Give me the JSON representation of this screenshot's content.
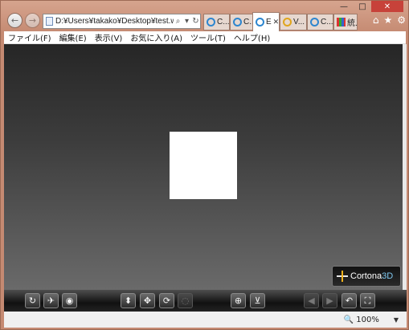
{
  "window": {
    "controls": {
      "minimize": "—",
      "maximize": "□",
      "close": "✕"
    }
  },
  "nav": {
    "back_icon": "back-arrow-icon",
    "forward_icon": "forward-arrow-icon",
    "address": "D:¥Users¥takako¥Desktop¥test.wrl",
    "search_icon": "⌕",
    "dropdown_icon": "▾",
    "refresh_icon": "↻"
  },
  "tabs": [
    {
      "label": "C...",
      "icon": "ie-icon"
    },
    {
      "label": "C...",
      "icon": "ie-icon"
    },
    {
      "label": "E",
      "icon": "ie-icon",
      "active": true,
      "close": "✕"
    },
    {
      "label": "V...",
      "icon": "yellow-ie-icon"
    },
    {
      "label": "C...",
      "icon": "ie-icon"
    },
    {
      "label": "統...",
      "icon": "multicolor-icon"
    }
  ],
  "right_icons": {
    "home": "⌂",
    "favorites": "★",
    "settings": "⚙"
  },
  "menu": [
    "ファイル(F)",
    "編集(E)",
    "表示(V)",
    "お気に入り(A)",
    "ツール(T)",
    "ヘルプ(H)"
  ],
  "viewer": {
    "logo_text": "Cortona",
    "logo_suffix": "3D",
    "background_top": "#262626",
    "background_bottom": "#6a6a6a"
  },
  "toolbar": {
    "buttons": [
      {
        "name": "walk-button",
        "glyph": "↻"
      },
      {
        "name": "fly-button",
        "glyph": "✈"
      },
      {
        "name": "study-button",
        "glyph": "◉"
      },
      {
        "name": "plan-button",
        "glyph": "⬍"
      },
      {
        "name": "pan-button",
        "glyph": "✥"
      },
      {
        "name": "turn-button",
        "glyph": "⟳"
      },
      {
        "name": "roll-button",
        "glyph": "◌"
      },
      {
        "name": "goto-button",
        "glyph": "⊕"
      },
      {
        "name": "align-button",
        "glyph": "⊻"
      },
      {
        "name": "prev-viewpoint-button",
        "glyph": "◀"
      },
      {
        "name": "next-viewpoint-button",
        "glyph": "▶"
      },
      {
        "name": "restore-button",
        "glyph": "↶"
      },
      {
        "name": "fit-button",
        "glyph": "⛶"
      }
    ]
  },
  "status": {
    "zoom": "100%",
    "zoom_icon": "🔍",
    "zoom_dropdown": "▼"
  }
}
